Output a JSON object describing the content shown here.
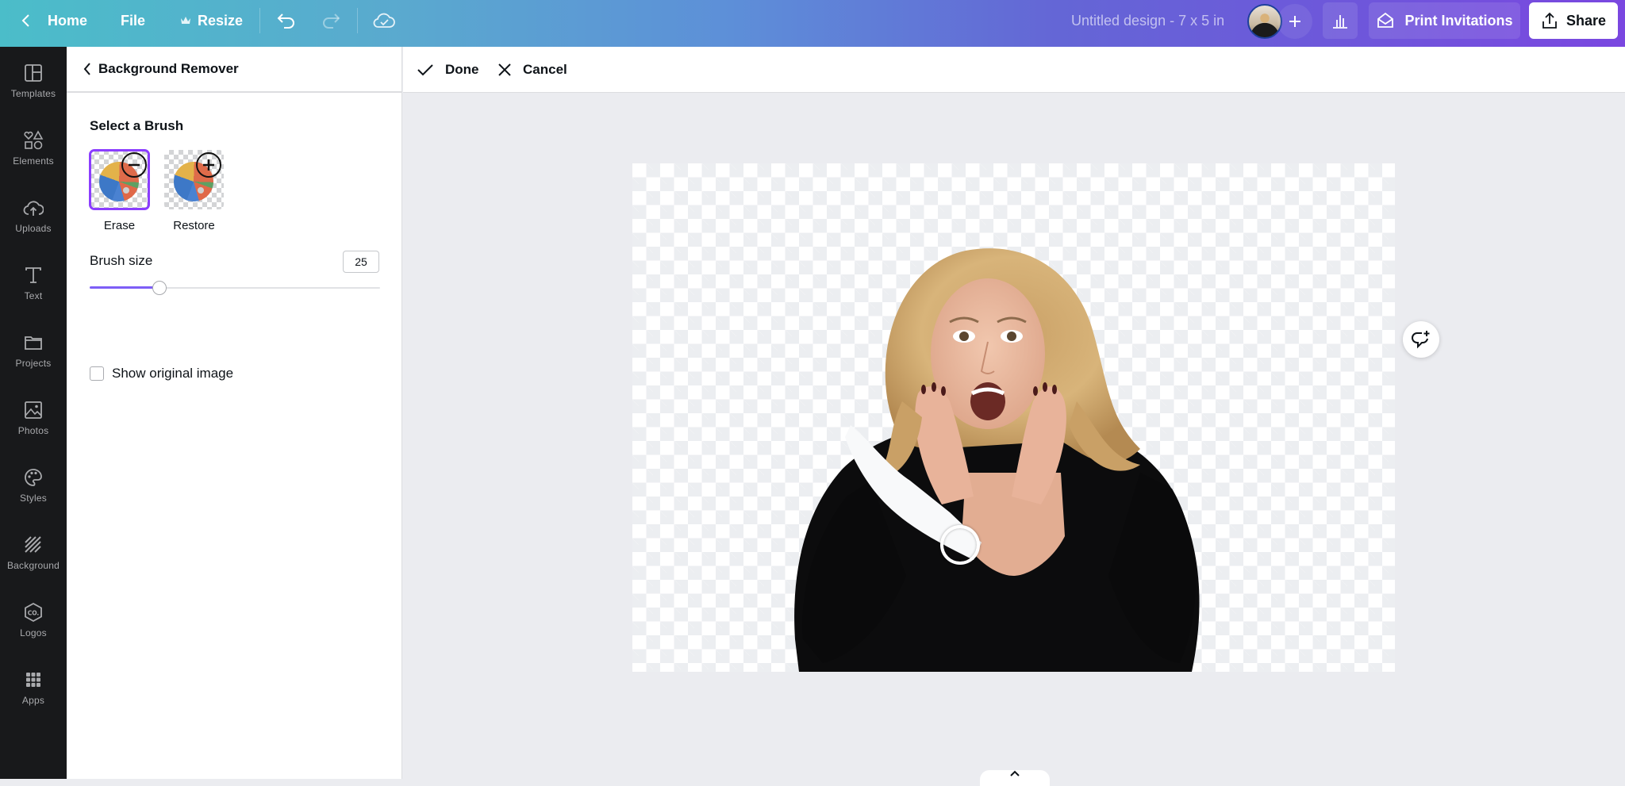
{
  "topbar": {
    "home_label": "Home",
    "file_label": "File",
    "resize_label": "Resize",
    "design_title": "Untitled design - 7 x 5 in",
    "print_label": "Print Invitations",
    "share_label": "Share"
  },
  "sidebar": {
    "items": [
      {
        "label": "Templates",
        "icon": "templates-icon"
      },
      {
        "label": "Elements",
        "icon": "elements-icon"
      },
      {
        "label": "Uploads",
        "icon": "uploads-icon"
      },
      {
        "label": "Text",
        "icon": "text-icon"
      },
      {
        "label": "Projects",
        "icon": "projects-icon"
      },
      {
        "label": "Photos",
        "icon": "photos-icon"
      },
      {
        "label": "Styles",
        "icon": "styles-icon"
      },
      {
        "label": "Background",
        "icon": "background-icon"
      },
      {
        "label": "Logos",
        "icon": "logos-icon"
      },
      {
        "label": "Apps",
        "icon": "apps-icon"
      }
    ]
  },
  "panel": {
    "title": "Background Remover",
    "section_title": "Select a Brush",
    "brushes": [
      {
        "label": "Erase",
        "selected": true
      },
      {
        "label": "Restore",
        "selected": false
      }
    ],
    "brush_size_label": "Brush size",
    "brush_size_value": "25",
    "brush_size_fraction": 0.24,
    "show_original_label": "Show original image",
    "show_original_checked": false
  },
  "editbar": {
    "done_label": "Done",
    "cancel_label": "Cancel"
  },
  "colors": {
    "accent": "#8b3dff",
    "slider_fill": "#7d5ef7",
    "sidebar_bg": "#18191b",
    "workspace_bg": "#ebecf0"
  }
}
